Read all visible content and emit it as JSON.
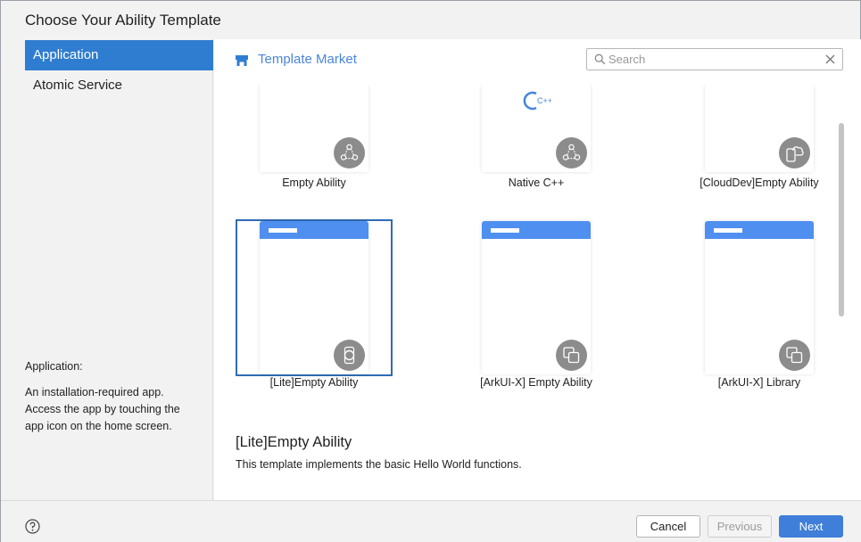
{
  "dialog": {
    "title": "Choose Your Ability Template"
  },
  "sidebar": {
    "items": [
      {
        "label": "Application",
        "active": true
      },
      {
        "label": "Atomic Service",
        "active": false
      }
    ],
    "description": {
      "title": "Application:",
      "body": "An installation-required app. Access the app by touching the app icon on the home screen."
    }
  },
  "market": {
    "label": "Template Market",
    "icon": "store-icon"
  },
  "search": {
    "placeholder": "Search",
    "value": ""
  },
  "templates": [
    {
      "label": "Empty Ability",
      "badge_icon": "nodes-icon"
    },
    {
      "label": "Native C++",
      "badge_icon": "nodes-icon",
      "logo": "C++"
    },
    {
      "label": "[CloudDev]Empty Ability",
      "badge_icon": "cloud-device-icon"
    },
    {
      "label": "[Lite]Empty Ability",
      "badge_icon": "watch-icon",
      "selected": true
    },
    {
      "label": "[ArkUI-X] Empty Ability",
      "badge_icon": "multi-device-icon"
    },
    {
      "label": "[ArkUI-X] Library",
      "badge_icon": "multi-device-icon"
    }
  ],
  "selected_detail": {
    "title": "[Lite]Empty Ability",
    "description": "This template implements the basic Hello World functions."
  },
  "footer": {
    "cancel": "Cancel",
    "previous": "Previous",
    "next": "Next",
    "help_icon": "help-icon"
  },
  "colors": {
    "accent": "#2f7dd1",
    "preview_bar": "#4f8ff0",
    "badge": "#8c8c8c",
    "next_button": "#3f7fd9"
  }
}
